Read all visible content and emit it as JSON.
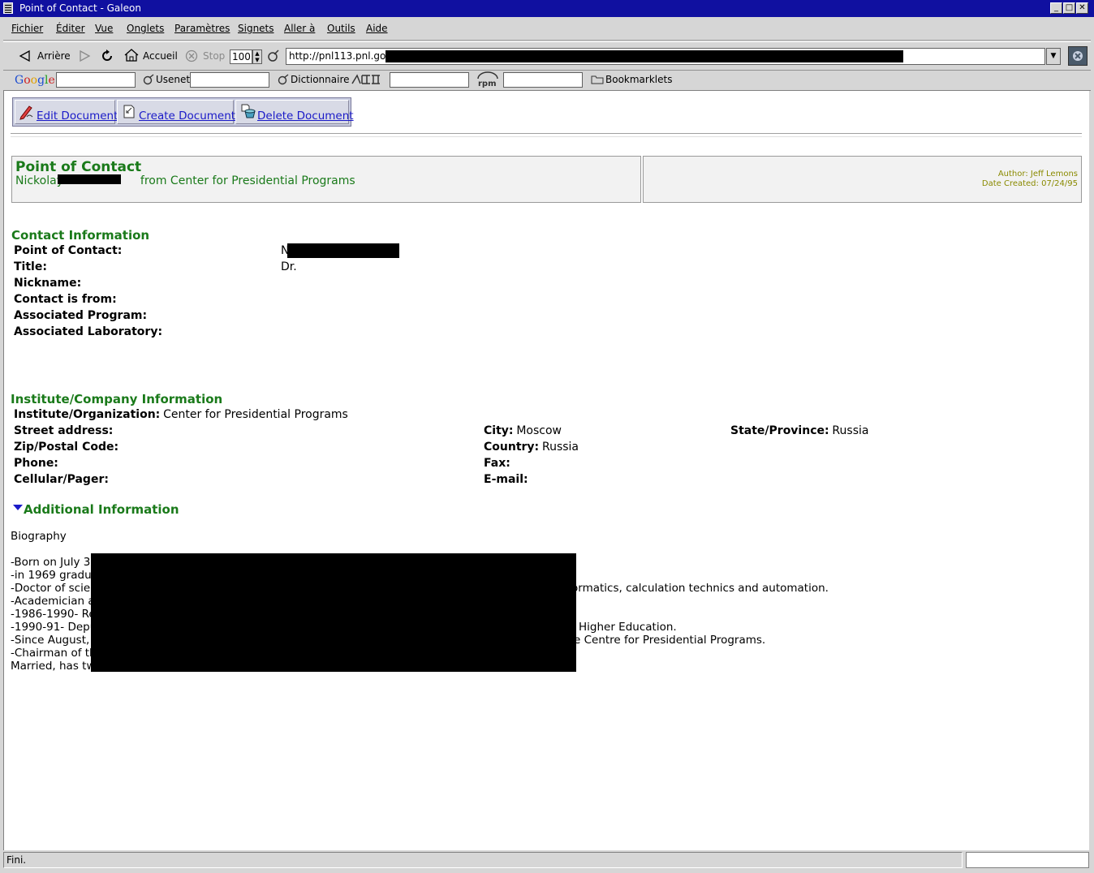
{
  "window": {
    "title": "Point of Contact - Galeon"
  },
  "menu": [
    "Fichier",
    "Éditer",
    "Vue",
    "Onglets",
    "Paramètres",
    "Signets",
    "Aller à",
    "Outils",
    "Aide"
  ],
  "navbar": {
    "back": "Arrière",
    "home": "Accueil",
    "stop": "Stop",
    "zoom": "100",
    "url": "http://pnl113.pnl.gov/"
  },
  "searchbar": {
    "usenet": "Usenet",
    "dictionary": "Dictionnaire",
    "bookmarklets": "Bookmarklets"
  },
  "doc_actions": {
    "edit": "Edit Document",
    "create": "Create Document",
    "delete": "Delete Document"
  },
  "poc_header": {
    "title": "Point of Contact",
    "subtitle_prefix": "Nickolay",
    "subtitle_suffix": "from Center for Presidential Programs",
    "author": "Author: Jeff Lemons",
    "date_created": "Date Created: 07/24/95"
  },
  "contact": {
    "heading": "Contact Information",
    "labels": {
      "poc": "Point of Contact:",
      "title": "Title:",
      "nickname": "Nickname:",
      "from": "Contact is from:",
      "program": "Associated Program:",
      "lab": "Associated Laboratory:"
    },
    "values": {
      "poc": "N",
      "title": "Dr."
    }
  },
  "institute": {
    "heading": "Institute/Company Information",
    "org_label": "Institute/Organization:",
    "org_value": "Center for Presidential Programs",
    "street_label": "Street address:",
    "city_label": "City:",
    "city_value": "Moscow",
    "state_label": "State/Province:",
    "state_value": "Russia",
    "zip_label": "Zip/Postal Code:",
    "country_label": "Country:",
    "country_value": "Russia",
    "phone_label": "Phone:",
    "fax_label": "Fax:",
    "cell_label": "Cellular/Pager:",
    "email_label": "E-mail:"
  },
  "additional": {
    "heading": "Additional Information",
    "bio_title": "Biography",
    "lines": [
      {
        "left": "-Born on July 3",
        "right": ""
      },
      {
        "left": "-in 1969 gradua",
        "right": ""
      },
      {
        "left": "-Doctor of scie",
        "right": "ormatics, calculation technics and automation."
      },
      {
        "left": "-Academician a",
        "right": ""
      },
      {
        "left": "-1986-1990- Re",
        "right": ""
      },
      {
        "left": "-1990-91- Depu",
        "right": "Higher Education."
      },
      {
        "left": "-Since August,",
        "right": "e Centre for Presidential Programs."
      },
      {
        "left": "-Chairman of th",
        "right": ""
      },
      {
        "left": "Married, has tw",
        "right": ""
      }
    ]
  },
  "status": {
    "text": "Fini."
  }
}
